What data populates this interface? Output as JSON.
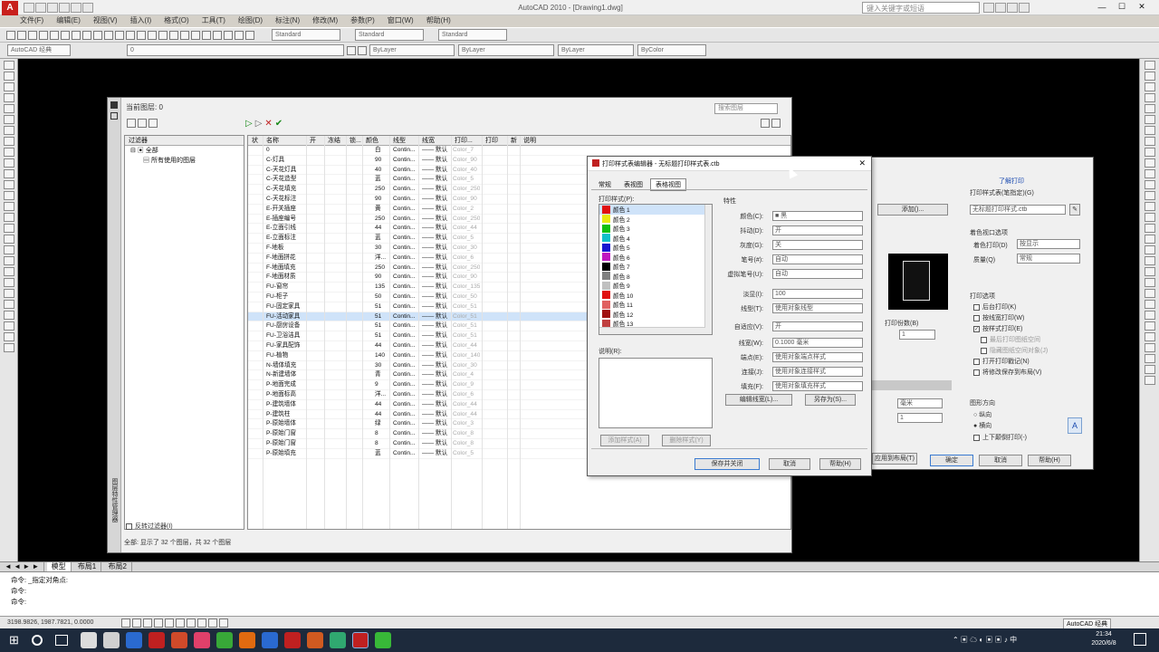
{
  "app": {
    "title": "AutoCAD 2010 - [Drawing1.dwg]",
    "logo": "A",
    "search_placeholder": "键入关键字或短语"
  },
  "menubar": [
    "文件(F)",
    "编辑(E)",
    "视图(V)",
    "插入(I)",
    "格式(O)",
    "工具(T)",
    "绘图(D)",
    "标注(N)",
    "修改(M)",
    "参数(P)",
    "窗口(W)",
    "帮助(H)"
  ],
  "toolbar": {
    "workspace": "AutoCAD 经典",
    "text_style": "Standard",
    "dim_style": "Standard",
    "table_style": "Standard",
    "layer_combo": "0",
    "color_combo": "ByLayer",
    "linetype_combo": "ByLayer",
    "lineweight_combo": "ByLayer",
    "plotstyle_combo": "ByColor"
  },
  "layer_manager": {
    "strip_label": "图层特性管理器",
    "current_layer": "当前图层: 0",
    "search_placeholder": "搜索图层",
    "tree": {
      "header": "过滤器",
      "root": "全部",
      "child": "所有使用的图层",
      "invert_filter": "反转过滤器(I)"
    },
    "columns": [
      "状",
      "名称",
      "开",
      "冻结",
      "锁...",
      "颜色",
      "线型",
      "线宽",
      "打印...",
      "打印",
      "新",
      "说明"
    ],
    "rows": [
      {
        "name": "0",
        "color_name": "白",
        "color": "#ffffff",
        "ltype": "Contin...",
        "lweight": "—— 默认",
        "pstyle": "Color_7"
      },
      {
        "name": "C-灯具",
        "color_name": "90",
        "color": "#2a8a2a",
        "ltype": "Contin...",
        "lweight": "—— 默认",
        "pstyle": "Color_90"
      },
      {
        "name": "C-天花灯具",
        "color_name": "40",
        "color": "#c08a1e",
        "ltype": "Contin...",
        "lweight": "—— 默认",
        "pstyle": "Color_40"
      },
      {
        "name": "C-天花造型",
        "color_name": "蓝",
        "color": "#1a1ad0",
        "ltype": "Contin...",
        "lweight": "—— 默认",
        "pstyle": "Color_5"
      },
      {
        "name": "C-天花填充",
        "color_name": "250",
        "color": "#333333",
        "ltype": "Contin...",
        "lweight": "—— 默认",
        "pstyle": "Color_250"
      },
      {
        "name": "C-天花标注",
        "color_name": "90",
        "color": "#2a8a2a",
        "ltype": "Contin...",
        "lweight": "—— 默认",
        "pstyle": "Color_90"
      },
      {
        "name": "E-开关插座",
        "color_name": "黄",
        "color": "#e8e83a",
        "ltype": "Contin...",
        "lweight": "—— 默认",
        "pstyle": "Color_2"
      },
      {
        "name": "E-插座编号",
        "color_name": "250",
        "color": "#333333",
        "ltype": "Contin...",
        "lweight": "—— 默认",
        "pstyle": "Color_250"
      },
      {
        "name": "E-立面引线",
        "color_name": "44",
        "color": "#a88a10",
        "ltype": "Contin...",
        "lweight": "—— 默认",
        "pstyle": "Color_44"
      },
      {
        "name": "E-立面标注",
        "color_name": "蓝",
        "color": "#1a1ad0",
        "ltype": "Contin...",
        "lweight": "—— 默认",
        "pstyle": "Color_5"
      },
      {
        "name": "F-地板",
        "color_name": "30",
        "color": "#e07a10",
        "ltype": "Contin...",
        "lweight": "—— 默认",
        "pstyle": "Color_30"
      },
      {
        "name": "F-地面拼花",
        "color_name": "洋...",
        "color": "#c030c0",
        "ltype": "Contin...",
        "lweight": "—— 默认",
        "pstyle": "Color_6"
      },
      {
        "name": "F-地面填充",
        "color_name": "250",
        "color": "#333333",
        "ltype": "Contin...",
        "lweight": "—— 默认",
        "pstyle": "Color_250"
      },
      {
        "name": "F-地面材质",
        "color_name": "90",
        "color": "#2a8a2a",
        "ltype": "Contin...",
        "lweight": "—— 默认",
        "pstyle": "Color_90"
      },
      {
        "name": "FU-窗帘",
        "color_name": "135",
        "color": "#3a9a8a",
        "ltype": "Contin...",
        "lweight": "—— 默认",
        "pstyle": "Color_135"
      },
      {
        "name": "FU-柜子",
        "color_name": "50",
        "color": "#c8c050",
        "ltype": "Contin...",
        "lweight": "—— 默认",
        "pstyle": "Color_50"
      },
      {
        "name": "FU-固定家具",
        "color_name": "51",
        "color": "#d0d070",
        "ltype": "Contin...",
        "lweight": "—— 默认",
        "pstyle": "Color_51"
      },
      {
        "name": "FU-活动家具",
        "color_name": "51",
        "color": "#d0d070",
        "ltype": "Contin...",
        "lweight": "—— 默认",
        "pstyle": "Color_51"
      },
      {
        "name": "FU-厨房设备",
        "color_name": "51",
        "color": "#d0d070",
        "ltype": "Contin...",
        "lweight": "—— 默认",
        "pstyle": "Color_51"
      },
      {
        "name": "FU-卫浴洁具",
        "color_name": "51",
        "color": "#d0d070",
        "ltype": "Contin...",
        "lweight": "—— 默认",
        "pstyle": "Color_51"
      },
      {
        "name": "FU-家具配饰",
        "color_name": "44",
        "color": "#a88a10",
        "ltype": "Contin...",
        "lweight": "—— 默认",
        "pstyle": "Color_44"
      },
      {
        "name": "FU-植物",
        "color_name": "140",
        "color": "#2a9a9a",
        "ltype": "Contin...",
        "lweight": "—— 默认",
        "pstyle": "Color_140"
      },
      {
        "name": "N-墙体填充",
        "color_name": "30",
        "color": "#e07a10",
        "ltype": "Contin...",
        "lweight": "—— 默认",
        "pstyle": "Color_30"
      },
      {
        "name": "N-新建墙体",
        "color_name": "青",
        "color": "#10c0c8",
        "ltype": "Contin...",
        "lweight": "—— 默认",
        "pstyle": "Color_4"
      },
      {
        "name": "P-地面完成",
        "color_name": "9",
        "color": "#bcbcbc",
        "ltype": "Contin...",
        "lweight": "—— 默认",
        "pstyle": "Color_9"
      },
      {
        "name": "P-地面标高",
        "color_name": "洋...",
        "color": "#c030c0",
        "ltype": "Contin...",
        "lweight": "—— 默认",
        "pstyle": "Color_6"
      },
      {
        "name": "P-建筑墙体",
        "color_name": "44",
        "color": "#a88a10",
        "ltype": "Contin...",
        "lweight": "—— 默认",
        "pstyle": "Color_44"
      },
      {
        "name": "P-建筑柱",
        "color_name": "44",
        "color": "#a88a10",
        "ltype": "Contin...",
        "lweight": "—— 默认",
        "pstyle": "Color_44"
      },
      {
        "name": "P-原始墙体",
        "color_name": "绿",
        "color": "#18b818",
        "ltype": "Contin...",
        "lweight": "—— 默认",
        "pstyle": "Color_3"
      },
      {
        "name": "P-原始门窗",
        "color_name": "8",
        "color": "#808080",
        "ltype": "Contin...",
        "lweight": "—— 默认",
        "pstyle": "Color_8"
      },
      {
        "name": "P-原始门窗",
        "color_name": "8",
        "color": "#808080",
        "ltype": "Contin...",
        "lweight": "—— 默认",
        "pstyle": "Color_8"
      },
      {
        "name": "P-原始填充",
        "color_name": "蓝",
        "color": "#1a1ad0",
        "ltype": "Contin...",
        "lweight": "—— 默认",
        "pstyle": "Color_5"
      }
    ],
    "status": "全部: 显示了 32 个图层，共 32 个图层"
  },
  "plot_style_editor": {
    "title": "打印样式表编辑器 - 无标题打印样式表.ctb",
    "tabs": [
      "常规",
      "表视图",
      "表格视图"
    ],
    "styles_label": "打印样式(P):",
    "styles": [
      {
        "name": "颜色 1",
        "color": "#e01010"
      },
      {
        "name": "颜色 2",
        "color": "#e8e810"
      },
      {
        "name": "颜色 3",
        "color": "#10c010"
      },
      {
        "name": "颜色 4",
        "color": "#10c0c8"
      },
      {
        "name": "颜色 5",
        "color": "#1818d0"
      },
      {
        "name": "颜色 6",
        "color": "#c018c0"
      },
      {
        "name": "颜色 7",
        "color": "#000000"
      },
      {
        "name": "颜色 8",
        "color": "#808080"
      },
      {
        "name": "颜色 9",
        "color": "#c0c0c0"
      },
      {
        "name": "颜色 10",
        "color": "#e01010"
      },
      {
        "name": "颜色 11",
        "color": "#e06060"
      },
      {
        "name": "颜色 12",
        "color": "#a01010"
      },
      {
        "name": "颜色 13",
        "color": "#c04040"
      }
    ],
    "desc_label": "说明(R):",
    "props_label": "特性",
    "fields": [
      {
        "label": "颜色(C):",
        "value": "■ 黑"
      },
      {
        "label": "抖动(D):",
        "value": "开"
      },
      {
        "label": "灰度(G):",
        "value": "关"
      },
      {
        "label": "笔号(#):",
        "value": "自动"
      },
      {
        "label": "虚拟笔号(U):",
        "value": "自动"
      },
      {
        "label": "淡显(I):",
        "value": "100"
      },
      {
        "label": "线型(T):",
        "value": "使用对象线型"
      },
      {
        "label": "自适应(V):",
        "value": "开"
      },
      {
        "label": "线宽(W):",
        "value": "0.1000 毫米"
      },
      {
        "label": "端点(E):",
        "value": "使用对象端点样式"
      },
      {
        "label": "连接(J):",
        "value": "使用对象连接样式"
      },
      {
        "label": "填充(F):",
        "value": "使用对象填充样式"
      }
    ],
    "edit_lineweights": "编辑线宽(L)...",
    "save_as": "另存为(S)...",
    "add_style": "添加样式(A)",
    "delete_style": "删除样式(Y)",
    "save_close": "保存并关闭",
    "cancel": "取消",
    "help": "帮助(H)"
  },
  "plot_dialog": {
    "help_link": "了解打印",
    "pstyle_label": "打印样式表(笔指定)(G)",
    "pstyle_value": "无标题打印样式.ctb",
    "add_btn": "添加()...",
    "shaded_label": "着色视口选项",
    "shade_plot": "着色打印(D)",
    "shade_value": "按显示",
    "quality": "质量(Q)",
    "quality_value": "常规",
    "options_label": "打印选项",
    "opts": [
      {
        "label": "后台打印(K)",
        "checked": false
      },
      {
        "label": "按线宽打印(W)",
        "checked": false
      },
      {
        "label": "按样式打印(E)",
        "checked": true
      },
      {
        "label": "最后打印图纸空间",
        "checked": false
      },
      {
        "label": "隐藏图纸空间对象(J)",
        "checked": false
      },
      {
        "label": "打开打印戳记(N)",
        "checked": false
      },
      {
        "label": "将修改保存到布局(V)",
        "checked": false
      }
    ],
    "orient_label": "图形方向",
    "portrait": "纵向",
    "landscape": "横向",
    "upside": "上下颠倒打印(-)",
    "offset_label": "打印份数(B)",
    "copies": "1",
    "unit": "毫米",
    "scale_value": "1",
    "ok": "确定",
    "cancel": "取消",
    "help": "帮助(H)",
    "apply_layout": "应用到布局(T)"
  },
  "model_tabs": [
    "模型",
    "布局1",
    "布局2"
  ],
  "command": {
    "lines": [
      "命令: _指定对角点:",
      "命令:",
      "命令:"
    ]
  },
  "status": {
    "coords": "3198.9826, 1987.7821, 0.0000",
    "right": "AutoCAD 经典"
  },
  "taskbar": {
    "time": "21:34",
    "date": "2020/6/8"
  }
}
